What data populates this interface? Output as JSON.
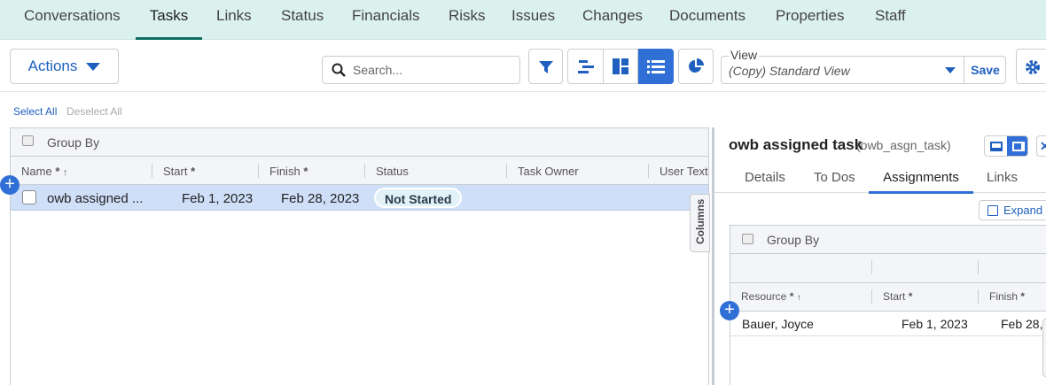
{
  "tabs": [
    "Conversations",
    "Tasks",
    "Links",
    "Status",
    "Financials",
    "Risks",
    "Issues",
    "Changes",
    "Documents",
    "Properties",
    "Staff"
  ],
  "toolbar": {
    "actions": "Actions",
    "search_placeholder": "Search...",
    "view_label": "View",
    "view_value": "(Copy) Standard View",
    "save": "Save"
  },
  "select_all": "Select All",
  "deselect_all": "Deselect All",
  "grid": {
    "group_by": "Group By",
    "columns_tab": "Columns",
    "headers": {
      "name": "Name",
      "start": "Start",
      "finish": "Finish",
      "status": "Status",
      "owner": "Task Owner",
      "usertext": "User Text"
    },
    "rows": [
      {
        "name": "owb assigned ...",
        "start": "Feb 1, 2023",
        "finish": "Feb 28, 2023",
        "status": "Not Started"
      }
    ]
  },
  "detail": {
    "title": "owb assigned task",
    "code": "(owb_asgn_task)",
    "tabs": [
      "Details",
      "To Dos",
      "Assignments",
      "Links"
    ],
    "expand": "Expand",
    "group_by": "Group By",
    "headers": {
      "resource": "Resource",
      "start": "Start",
      "finish": "Finish"
    },
    "rows": [
      {
        "resource": "Bauer, Joyce",
        "start": "Feb 1, 2023",
        "finish": "Feb 28,"
      }
    ]
  },
  "star": "*",
  "arrow": "↑",
  "colors": {
    "accent": "#2f6fd6",
    "tab_active": "#0e6e60"
  }
}
